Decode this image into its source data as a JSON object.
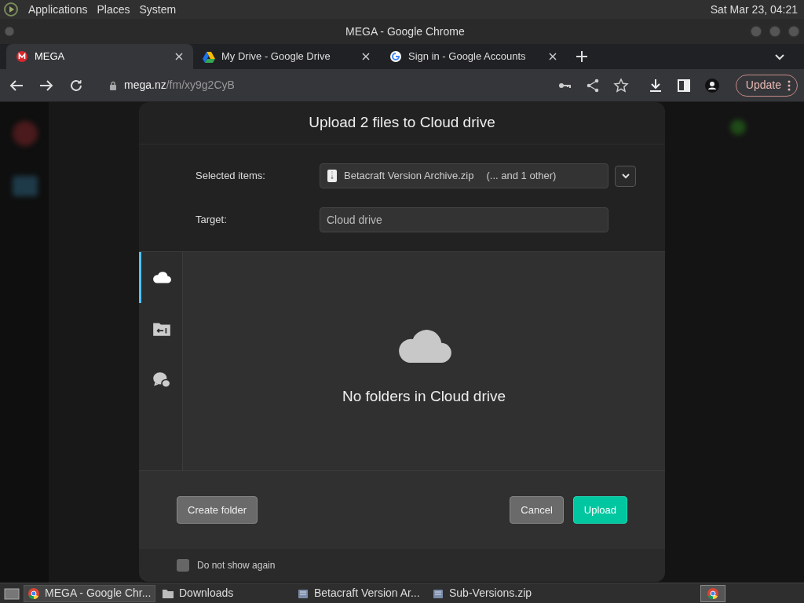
{
  "top_panel": {
    "menus": [
      "Applications",
      "Places",
      "System"
    ],
    "clock": "Sat Mar 23, 04:21"
  },
  "window": {
    "title": "MEGA - Google Chrome"
  },
  "tabs": [
    {
      "label": "MEGA",
      "kind": "mega",
      "selected": true
    },
    {
      "label": "My Drive - Google Drive",
      "kind": "drive",
      "selected": false
    },
    {
      "label": "Sign in - Google Accounts",
      "kind": "google",
      "selected": false
    }
  ],
  "address_bar": {
    "host": "mega.nz",
    "path": "/fm/xy9g2CyB",
    "update_label": "Update"
  },
  "dialog": {
    "title": "Upload 2 files to Cloud drive",
    "selected_items_label": "Selected items:",
    "selected_file": "Betacraft Version Archive.zip",
    "selected_more": "(... and 1 other)",
    "target_label": "Target:",
    "target_value": "Cloud drive",
    "rail": [
      {
        "kind": "cloud",
        "selected": true
      },
      {
        "kind": "folder",
        "selected": false
      },
      {
        "kind": "chat",
        "selected": false
      }
    ],
    "empty_text": "No folders in Cloud drive",
    "create_folder": "Create folder",
    "cancel": "Cancel",
    "upload": "Upload",
    "dont_show": {
      "label": "Do not show again",
      "checked": false
    }
  },
  "taskbar": [
    {
      "label": "MEGA - Google Chr...",
      "kind": "chrome",
      "selected": true
    },
    {
      "label": "Downloads",
      "kind": "folder",
      "selected": false
    },
    {
      "label": "Betacraft Version Ar...",
      "kind": "archive",
      "selected": false
    },
    {
      "label": "Sub-Versions.zip",
      "kind": "archive",
      "selected": false
    }
  ]
}
